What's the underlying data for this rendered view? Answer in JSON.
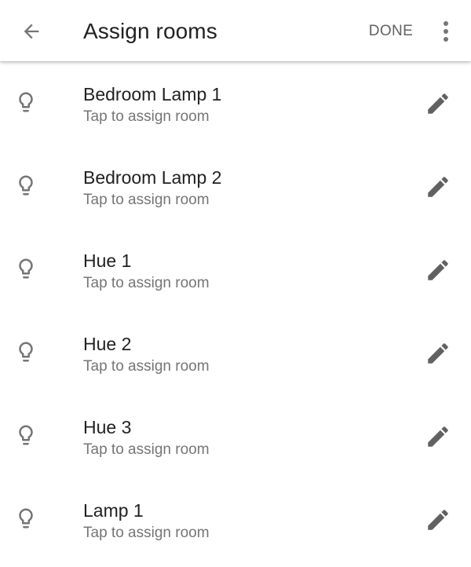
{
  "header": {
    "title": "Assign rooms",
    "done_label": "DONE",
    "back_icon": "arrow-back-icon",
    "more_icon": "more-vert-icon"
  },
  "devices": [
    {
      "name": "Bedroom Lamp 1",
      "subtitle": "Tap to assign room",
      "icon": "lightbulb-outline-icon",
      "action_icon": "edit-pencil-icon"
    },
    {
      "name": "Bedroom Lamp 2",
      "subtitle": "Tap to assign room",
      "icon": "lightbulb-outline-icon",
      "action_icon": "edit-pencil-icon"
    },
    {
      "name": "Hue 1",
      "subtitle": "Tap to assign room",
      "icon": "lightbulb-outline-icon",
      "action_icon": "edit-pencil-icon"
    },
    {
      "name": "Hue 2",
      "subtitle": "Tap to assign room",
      "icon": "lightbulb-outline-icon",
      "action_icon": "edit-pencil-icon"
    },
    {
      "name": "Hue 3",
      "subtitle": "Tap to assign room",
      "icon": "lightbulb-outline-icon",
      "action_icon": "edit-pencil-icon"
    },
    {
      "name": "Lamp 1",
      "subtitle": "Tap to assign room",
      "icon": "lightbulb-outline-icon",
      "action_icon": "edit-pencil-icon"
    }
  ],
  "colors": {
    "title_text": "#212121",
    "subtitle_text": "#757575",
    "icon": "#757575",
    "background": "#ffffff"
  }
}
